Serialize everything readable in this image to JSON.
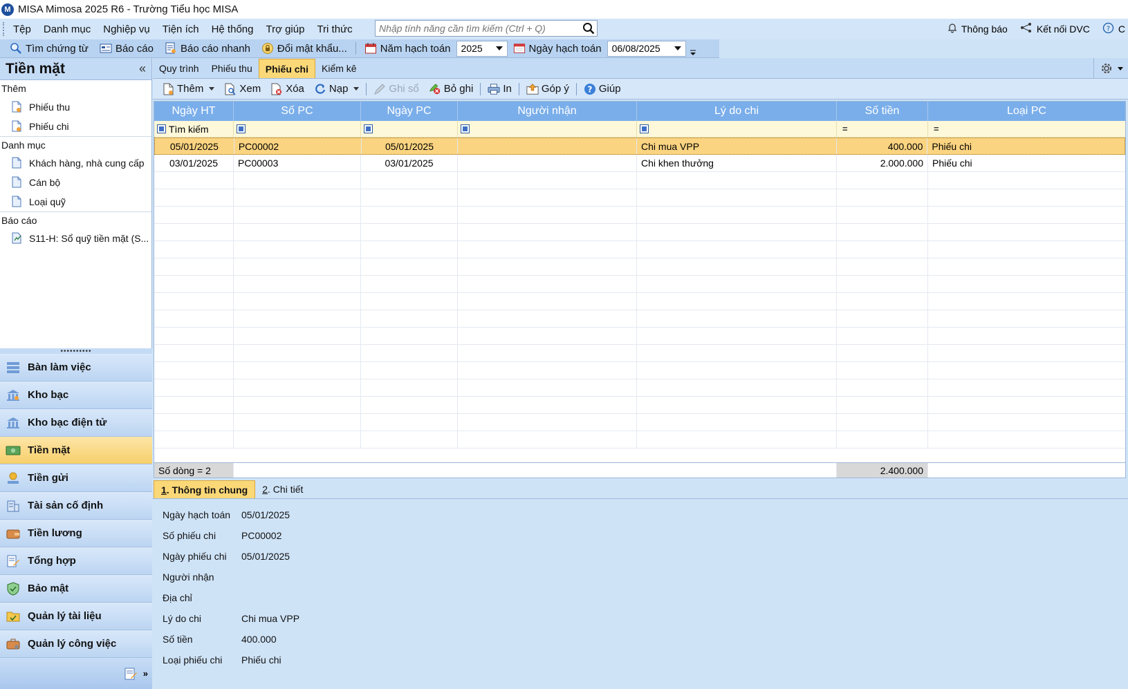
{
  "window": {
    "title": "MISA Mimosa 2025 R6 - Trường Tiểu học MISA"
  },
  "menu": {
    "items": [
      "Tệp",
      "Danh mục",
      "Nghiệp vụ",
      "Tiện ích",
      "Hệ thống",
      "Trợ giúp",
      "Tri thức"
    ],
    "search_placeholder": "Nhập tính năng cần tìm kiếm (Ctrl + Q)",
    "notify_label": "Thông báo",
    "connect_label": "Kết nối DVC",
    "help_short": "C"
  },
  "toolbar2": {
    "find_voucher": "Tìm chứng từ",
    "report": "Báo cáo",
    "quick_report": "Báo cáo nhanh",
    "change_password": "Đổi mật khẩu...",
    "fiscal_year_label": "Năm hạch toán",
    "fiscal_year_value": "2025",
    "posting_date_label": "Ngày hạch toán",
    "posting_date_value": "06/08/2025"
  },
  "sidebar": {
    "title": "Tiền mặt",
    "collapse_glyph": "«",
    "groups": [
      {
        "label": "Thêm",
        "items": [
          "Phiếu thu",
          "Phiếu chi"
        ]
      },
      {
        "label": "Danh mục",
        "items": [
          "Khách hàng, nhà cung cấp",
          "Cán bộ",
          "Loại quỹ"
        ]
      },
      {
        "label": "Báo cáo",
        "items": [
          "S11-H: Sổ quỹ tiền mặt (S..."
        ]
      }
    ],
    "nav": [
      {
        "label": "Bàn làm việc",
        "active": false
      },
      {
        "label": "Kho bạc",
        "active": false
      },
      {
        "label": "Kho bạc điện tử",
        "active": false
      },
      {
        "label": "Tiền mặt",
        "active": true
      },
      {
        "label": "Tiền gửi",
        "active": false
      },
      {
        "label": "Tài sản cố định",
        "active": false
      },
      {
        "label": "Tiền lương",
        "active": false
      },
      {
        "label": "Tổng hợp",
        "active": false
      },
      {
        "label": "Bảo mật",
        "active": false
      },
      {
        "label": "Quản lý tài liệu",
        "active": false
      },
      {
        "label": "Quản lý công việc",
        "active": false
      }
    ]
  },
  "tabs": [
    {
      "label": "Quy trình",
      "active": false
    },
    {
      "label": "Phiếu thu",
      "active": false
    },
    {
      "label": "Phiếu chi",
      "active": true
    },
    {
      "label": "Kiểm kê",
      "active": false
    }
  ],
  "actions": {
    "add": "Thêm",
    "view": "Xem",
    "delete": "Xóa",
    "reload": "Nạp",
    "post": "Ghi sổ",
    "unpost": "Bỏ ghi",
    "print": "In",
    "feedback": "Góp ý",
    "help": "Giúp"
  },
  "grid": {
    "columns": [
      "Ngày HT",
      "Số PC",
      "Ngày PC",
      "Người nhận",
      "Lý do chi",
      "Số tiền",
      "Loại PC"
    ],
    "filter_first": "Tìm kiếm",
    "rows": [
      {
        "ngay_ht": "05/01/2025",
        "so_pc": "PC00002",
        "ngay_pc": "05/01/2025",
        "nguoi_nhan": "",
        "ly_do": "Chi mua VPP",
        "so_tien": "400.000",
        "loai": "Phiếu chi",
        "selected": true
      },
      {
        "ngay_ht": "03/01/2025",
        "so_pc": "PC00003",
        "ngay_pc": "03/01/2025",
        "nguoi_nhan": "",
        "ly_do": "Chi khen thưởng",
        "so_tien": "2.000.000",
        "loai": "Phiếu chi",
        "selected": false
      }
    ],
    "footer_count": "Số dòng = 2",
    "footer_total": "2.400.000"
  },
  "detail": {
    "tabs": [
      {
        "num": "1",
        "label": ". Thông tin chung",
        "active": true
      },
      {
        "num": "2",
        "label": ". Chi tiết",
        "active": false
      }
    ],
    "fields": [
      {
        "label": "Ngày hạch toán",
        "value": "05/01/2025"
      },
      {
        "label": "Số phiếu chi",
        "value": "PC00002"
      },
      {
        "label": "Ngày phiếu chi",
        "value": "05/01/2025"
      },
      {
        "label": "Người nhận",
        "value": ""
      },
      {
        "label": "Địa chỉ",
        "value": ""
      },
      {
        "label": "Lý do chi",
        "value": "Chi mua VPP"
      },
      {
        "label": "Số tiền",
        "value": "400.000"
      },
      {
        "label": "Loại phiếu chi",
        "value": "Phiếu chi"
      }
    ]
  }
}
